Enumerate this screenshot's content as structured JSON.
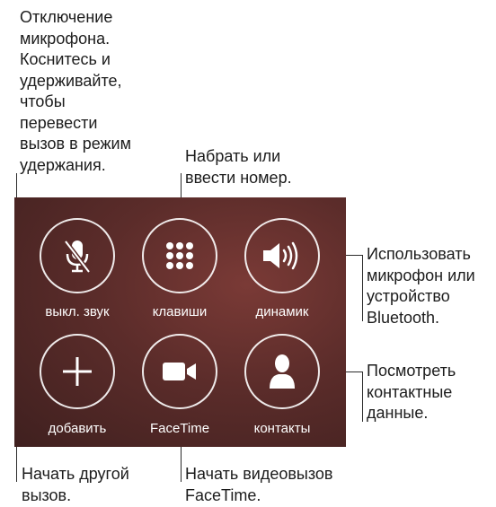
{
  "callouts": {
    "mute": [
      "Отключение",
      "микрофона.",
      "Коснитесь и",
      "удерживайте,",
      "чтобы",
      "перевести",
      "вызов в режим",
      "удержания."
    ],
    "keypad": [
      "Набрать или",
      "ввести номер."
    ],
    "speaker": [
      "Использовать",
      "микрофон или",
      "устройство",
      "Bluetooth."
    ],
    "contacts": [
      "Посмотреть",
      "контактные",
      "данные."
    ],
    "add": [
      "Начать другой",
      "вызов."
    ],
    "facetime": [
      "Начать видеовызов",
      "FaceTime."
    ]
  },
  "buttons": {
    "mute": {
      "label": "выкл. звук",
      "icon": "mic-off-icon"
    },
    "keypad": {
      "label": "клавиши",
      "icon": "keypad-grid-icon"
    },
    "speaker": {
      "label": "динамик",
      "icon": "speaker-icon"
    },
    "add": {
      "label": "добавить",
      "icon": "plus-icon"
    },
    "facetime": {
      "label": "FaceTime",
      "icon": "video-camera-icon"
    },
    "contacts": {
      "label": "контакты",
      "icon": "person-icon"
    }
  },
  "colors": {
    "panel": "#5b2c2a",
    "button_border": "#ffffff"
  }
}
